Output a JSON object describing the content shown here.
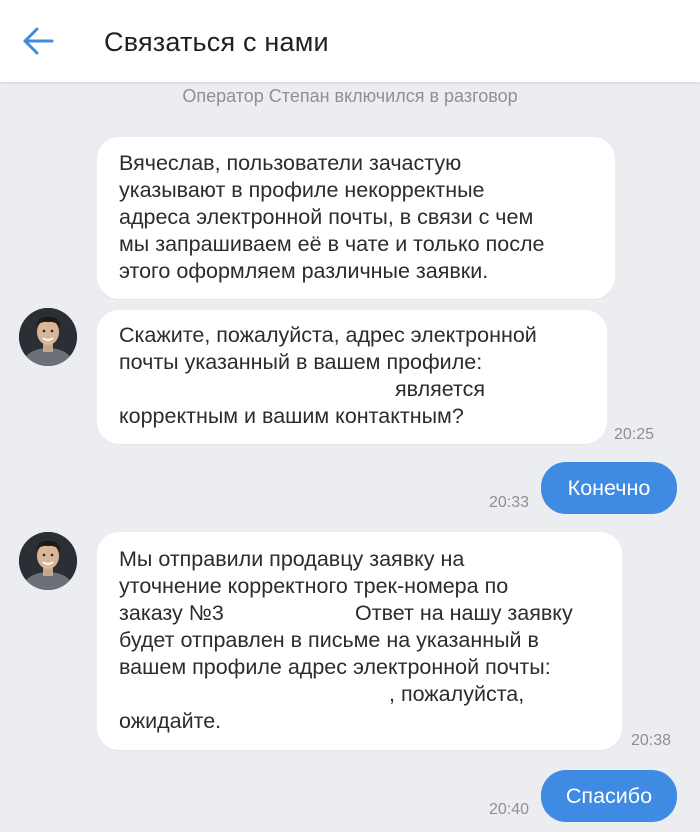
{
  "header": {
    "title": "Связаться с нами",
    "back_icon": "arrow-left-icon",
    "accent_color": "#3f8be3"
  },
  "system_message": "Оператор Степан включился в разговор",
  "messages": [
    {
      "direction": "incoming",
      "text": "Вячеслав, пользователи зачастую\nуказывают в профиле некорректные\nадреса электронной почты, в связи с чем\nмы запрашиваем её в чате и только после\nэтого оформляем различные заявки."
    },
    {
      "direction": "incoming",
      "text_line1": "Скажите, пожалуйста, адрес электронной",
      "text_line2": "почты указанный в вашем профиле:",
      "text_line3": "является",
      "text_line4": "корректным и вашим контактным?",
      "time": "20:25"
    },
    {
      "direction": "outgoing",
      "text": "Конечно",
      "time": "20:33"
    },
    {
      "direction": "incoming",
      "text_line1": "Мы отправили продавцу заявку на",
      "text_line2": "уточнение корректного трек-номера по",
      "text_line3a": "заказу №3",
      "text_line3b": "Ответ на нашу заявку",
      "text_line4": "будет отправлен в письме на указанный в",
      "text_line5": "вашем профиле адрес электронной почты:",
      "text_line6": ", пожалуйста,",
      "text_line7": "ожидайте.",
      "time": "20:38"
    },
    {
      "direction": "outgoing",
      "text": "Спасибо",
      "time": "20:40"
    }
  ],
  "avatar_icon": "operator-avatar-icon"
}
